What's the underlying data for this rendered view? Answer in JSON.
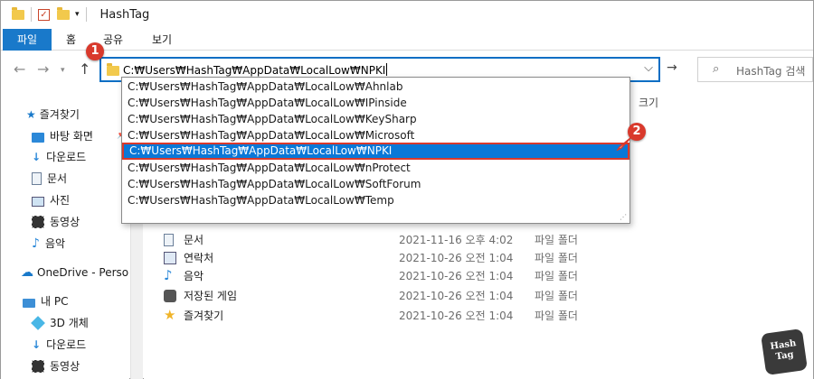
{
  "window": {
    "title": "HashTag"
  },
  "ribbon": {
    "tabs": [
      "파일",
      "홈",
      "공유",
      "보기"
    ]
  },
  "address": {
    "value": "C:₩Users₩HashTag₩AppData₩LocalLow₩NPKI"
  },
  "search": {
    "placeholder": "HashTag 검색"
  },
  "autocomplete": {
    "items": [
      "C:₩Users₩HashTag₩AppData₩LocalLow₩Ahnlab",
      "C:₩Users₩HashTag₩AppData₩LocalLow₩IPinside",
      "C:₩Users₩HashTag₩AppData₩LocalLow₩KeySharp",
      "C:₩Users₩HashTag₩AppData₩LocalLow₩Microsoft",
      "C:₩Users₩HashTag₩AppData₩LocalLow₩NPKI",
      "C:₩Users₩HashTag₩AppData₩LocalLow₩nProtect",
      "C:₩Users₩HashTag₩AppData₩LocalLow₩SoftForum",
      "C:₩Users₩HashTag₩AppData₩LocalLow₩Temp"
    ],
    "selected_index": 4
  },
  "badges": {
    "step1": "1",
    "step2": "2"
  },
  "sidebar": {
    "quick_access": "즐겨찾기",
    "items": [
      {
        "label": "바탕 화면",
        "icon": "desktop-icon"
      },
      {
        "label": "다운로드",
        "icon": "download-icon"
      },
      {
        "label": "문서",
        "icon": "document-icon"
      },
      {
        "label": "사진",
        "icon": "picture-icon"
      },
      {
        "label": "동영상",
        "icon": "video-icon"
      },
      {
        "label": "음악",
        "icon": "music-icon"
      }
    ],
    "onedrive": "OneDrive - Person",
    "this_pc": "내 PC",
    "pc_items": [
      {
        "label": "3D 개체",
        "icon": "3d-objects-icon"
      },
      {
        "label": "다운로드",
        "icon": "download-icon"
      },
      {
        "label": "동영상",
        "icon": "video-icon"
      }
    ]
  },
  "content": {
    "size_header": "크기",
    "rows": [
      {
        "name": "문서",
        "date": "2021-11-16 오후 4:02",
        "type": "파일 폴더",
        "icon": "document-icon"
      },
      {
        "name": "연락처",
        "date": "2021-10-26 오전 1:04",
        "type": "파일 폴더",
        "icon": "contacts-icon"
      },
      {
        "name": "음악",
        "date": "2021-10-26 오전 1:04",
        "type": "파일 폴더",
        "icon": "music-icon"
      },
      {
        "name": "저장된 게임",
        "date": "2021-10-26 오전 1:04",
        "type": "파일 폴더",
        "icon": "saved-games-icon"
      },
      {
        "name": "즐겨찾기",
        "date": "2021-10-26 오전 1:04",
        "type": "파일 폴더",
        "icon": "favorites-star-icon"
      }
    ]
  },
  "watermark": {
    "line1": "Hash",
    "line2": "Tag"
  },
  "colors": {
    "accent": "#0a78d7",
    "file_tab": "#1979ca",
    "badge": "#d9392c",
    "folder": "#f2c94c"
  }
}
